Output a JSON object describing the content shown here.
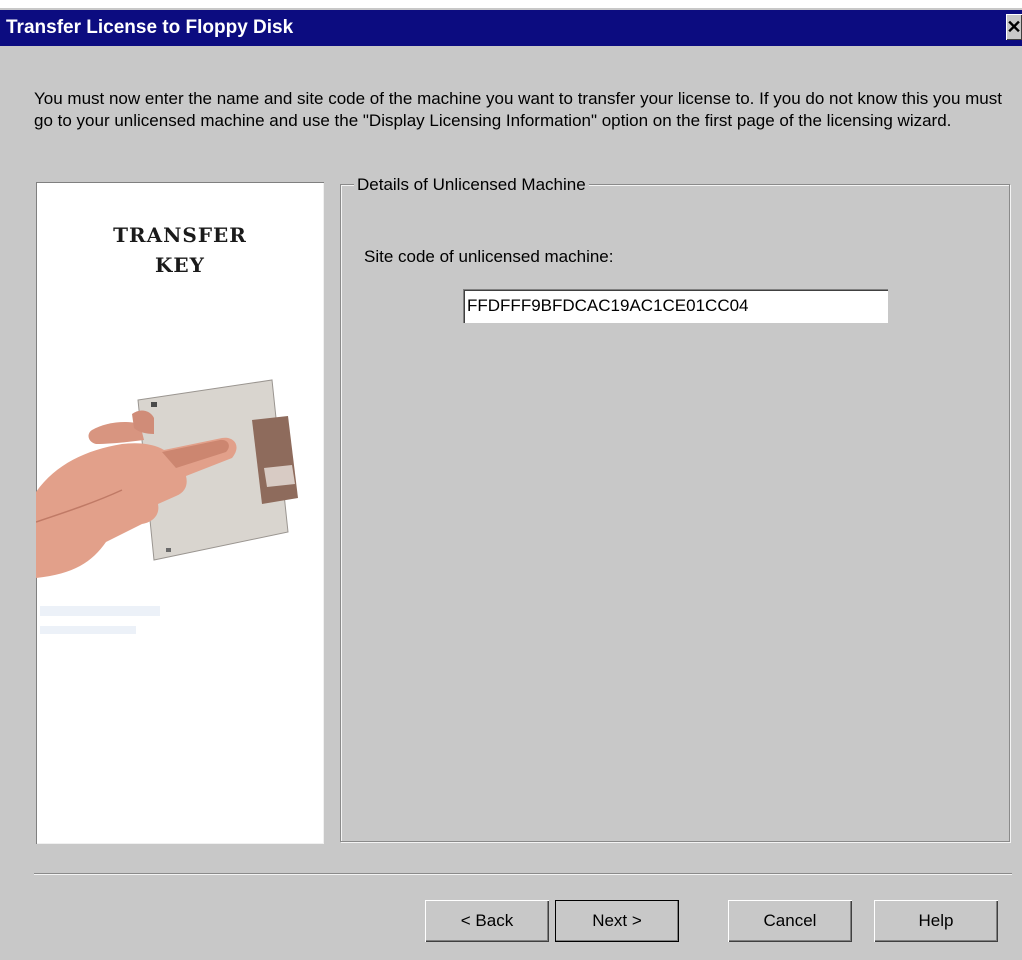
{
  "window": {
    "title": "Transfer License to Floppy Disk",
    "close_glyph": "✕"
  },
  "instructions": "You must now enter the name and site code of the machine you want to transfer your license to. If you do not know this you must go to your unlicensed machine and use the \"Display Licensing Information\" option on the first page of the licensing wizard.",
  "art_panel": {
    "title_line1": "TRANSFER",
    "title_line2": "KEY",
    "illustration": "hand-holding-floppy-disk"
  },
  "group": {
    "legend": "Details of Unlicensed Machine",
    "site_code_label": "Site code of unlicensed machine:",
    "site_code_value": "FFDFFF9BFDCAC19AC1CE01CC04"
  },
  "buttons": {
    "back": "< Back",
    "next": "Next >",
    "cancel": "Cancel",
    "help": "Help"
  }
}
